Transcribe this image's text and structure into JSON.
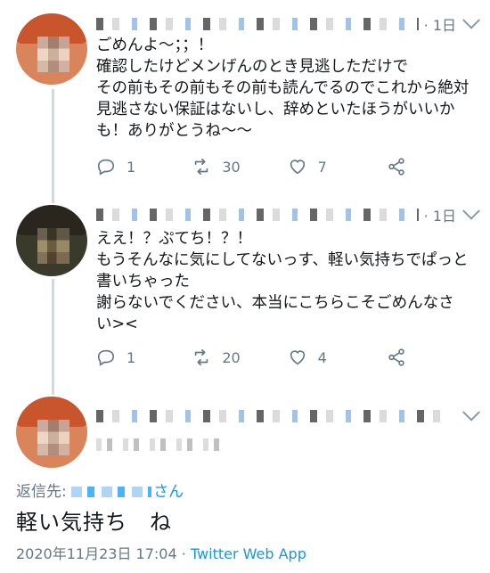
{
  "tweets": [
    {
      "time": "· 1日",
      "text": "ごめんよ〜；；！\n確認したけどメンげんのとき見逃しただけで\nその前もその前もその前も読んでるのでこれから絶対\n見逃さない保証はないし、辞めといたほうがいいか\nも！ありがとうね〜〜",
      "replies": "1",
      "retweets": "30",
      "likes": "7"
    },
    {
      "time": "· 1日",
      "text": "ええ！？ぷてち！？！\nもうそんなに気にしてないっす、軽い気持ちでぱっと\n書いちゃった\n謝らないでください、本当にこちらこそごめんなさ\nい><",
      "replies": "1",
      "retweets": "20",
      "likes": "4"
    }
  ],
  "focused": {
    "reply_to_label": "返信先:",
    "reply_to_suffix": "さん",
    "text": "軽い気持ち　ね",
    "date": "2020年11月23日 17:04",
    "separator": " · ",
    "app": "Twitter Web App"
  }
}
